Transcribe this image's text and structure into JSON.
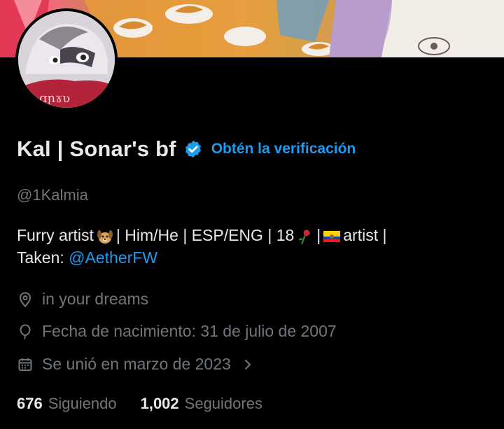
{
  "profile": {
    "display_name": "Kal | Sonar's bf",
    "verify_link": "Obtén la verificación",
    "handle": "@1Kalmia",
    "bio": {
      "line1_a": "Furry artist",
      "line1_b": "| Him/He | ESP/ENG | 18",
      "line1_c": "|",
      "line1_d": "artist |",
      "line2_prefix": "Taken:",
      "line2_mention": "@AetherFW"
    },
    "location": "in your dreams",
    "birthday": "Fecha de nacimiento: 31 de julio de 2007",
    "joined": "Se unió en marzo de 2023"
  },
  "stats": {
    "following_count": "676",
    "following_label": "Siguiendo",
    "followers_count": "1,002",
    "followers_label": "Seguidores"
  },
  "icons": {
    "verified": "verified-badge-icon",
    "location": "location-pin-icon",
    "birthday": "balloon-icon",
    "joined": "calendar-icon",
    "chevron": "chevron-right-icon",
    "emoji_dog": "dog-emoji-icon",
    "emoji_rose": "wilted-rose-emoji-icon",
    "emoji_flag": "ecuador-flag-emoji-icon"
  },
  "colors": {
    "background": "#000000",
    "primary_text": "#e7e9ea",
    "secondary_text": "#71767b",
    "accent": "#1d9bf0"
  }
}
